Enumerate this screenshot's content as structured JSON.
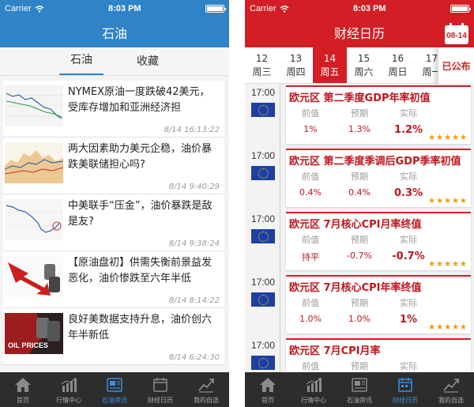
{
  "left": {
    "status": {
      "carrier": "Carrier",
      "time": "8:03 PM"
    },
    "title": "石油",
    "tabs": [
      {
        "label": "石油",
        "active": true
      },
      {
        "label": "收藏",
        "active": false
      }
    ],
    "news": [
      {
        "title": "NYMEX原油一度跌破42美元，受库存增加和亚洲经济担",
        "time": "8/14 16:13:22",
        "thumb": "chart-thumbnail"
      },
      {
        "title": "两大因素助力美元企稳，油价暴跌美联储担心吗?",
        "time": "8/14 9:40:29",
        "thumb": "chart-thumbnail"
      },
      {
        "title": "中美联手“压金”，油价暴跌是敌是友?",
        "time": "8/14 9:38:24",
        "thumb": "chart-thumbnail"
      },
      {
        "title": "【原油盘初】供需失衡前景益发恶化，油价惨跌至六年半低",
        "time": "8/14 8:14:22",
        "thumb": "falling-arrow-barrels-thumbnail"
      },
      {
        "title": "良好美数据支持升息，油价创六年半新低",
        "time": "8/14 6:24:30",
        "thumb": "oil-prices-thumbnail",
        "thumb_text": "OIL PRICES"
      }
    ],
    "tabbar": [
      {
        "label": "首页",
        "icon": "home-icon",
        "active": false
      },
      {
        "label": "行情中心",
        "icon": "market-chart-icon",
        "active": false
      },
      {
        "label": "石油资讯",
        "icon": "news-icon",
        "active": true
      },
      {
        "label": "财经日历",
        "icon": "calendar-icon",
        "active": false
      },
      {
        "label": "我的自选",
        "icon": "my-watchlist-icon",
        "active": false
      }
    ]
  },
  "right": {
    "status": {
      "carrier": "Carrier",
      "time": "8:03 PM"
    },
    "title": "财经日历",
    "calendar_badge": "08-14",
    "dates": [
      {
        "day": "12",
        "week": "周三",
        "active": false
      },
      {
        "day": "13",
        "week": "周四",
        "active": false
      },
      {
        "day": "14",
        "week": "周五",
        "active": true
      },
      {
        "day": "15",
        "week": "周六",
        "active": false
      },
      {
        "day": "16",
        "week": "周日",
        "active": false
      },
      {
        "day": "17",
        "week": "周一",
        "active": false
      }
    ],
    "published_label": "已公布",
    "col_labels": {
      "prev": "前值",
      "forecast": "预期",
      "actual": "实际"
    },
    "events": [
      {
        "time": "17:00",
        "title": "欧元区 第二季度GDP年率初值",
        "prev": "1%",
        "forecast": "1.3%",
        "actual": "1.2%",
        "stars": "★★★★★"
      },
      {
        "time": "17:00",
        "title": "欧元区 第二季度季调后GDP季率初值",
        "prev": "0.4%",
        "forecast": "0.4%",
        "actual": "0.3%",
        "stars": "★★★★★"
      },
      {
        "time": "17:00",
        "title": "欧元区 7月核心CPI月率终值",
        "prev": "持平",
        "forecast": "-0.7%",
        "actual": "-0.7%",
        "stars": "★★★★★"
      },
      {
        "time": "17:00",
        "title": "欧元区 7月核心CPI年率终值",
        "prev": "1.0%",
        "forecast": "1.0%",
        "actual": "1%",
        "stars": "★★★★★"
      },
      {
        "time": "17:00",
        "title": "欧元区 7月CPI月率",
        "prev": "",
        "forecast": "",
        "actual": "",
        "stars": ""
      }
    ],
    "tabbar": [
      {
        "label": "首页",
        "icon": "home-icon",
        "active": false
      },
      {
        "label": "行情中心",
        "icon": "market-chart-icon",
        "active": false
      },
      {
        "label": "石油资讯",
        "icon": "news-icon",
        "active": false
      },
      {
        "label": "财经日历",
        "icon": "calendar-icon",
        "active": true
      },
      {
        "label": "我的自选",
        "icon": "my-watchlist-icon",
        "active": false
      }
    ]
  },
  "colors": {
    "left_accent": "#2f83c7",
    "right_accent": "#d31e25",
    "tabbar_bg": "#2d2d2d",
    "active_tab": "#3a8fe0",
    "stars": "#f39800"
  }
}
